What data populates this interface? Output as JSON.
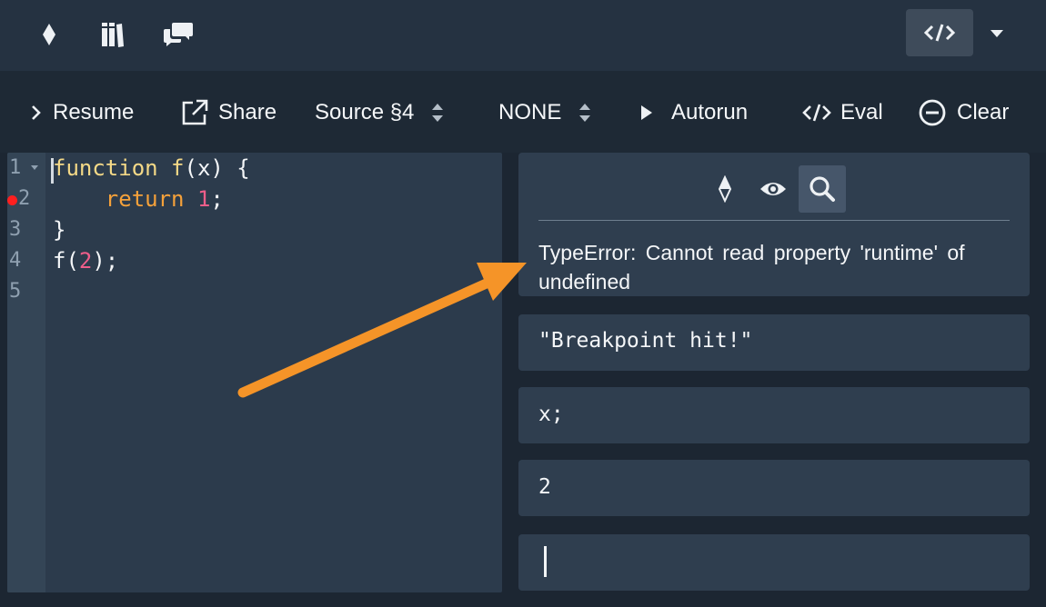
{
  "topbar": {
    "icons": [
      "playground-icon",
      "library-icon",
      "chat-icon"
    ],
    "code_toggle_icon": "code-icon",
    "dropdown_icon": "caret-down-icon"
  },
  "controls": {
    "resume": "Resume",
    "share": "Share",
    "source": "Source §4",
    "variant": "NONE",
    "autorun": "Autorun",
    "eval": "Eval",
    "clear": "Clear"
  },
  "editor": {
    "line_numbers": [
      "1",
      "2",
      "3",
      "4",
      "5"
    ],
    "breakpoint_line": "2",
    "lines": [
      {
        "kw": "function",
        "fn": "f",
        "rest": "(x) {"
      },
      {
        "ret": "return",
        "num": "1",
        "end": ";"
      },
      {
        "text": "}"
      },
      {
        "pre": "f(",
        "num": "2",
        "post": ");"
      },
      {
        "text": ""
      }
    ]
  },
  "repl": {
    "mode_icons": [
      "playground-icon",
      "eye-icon",
      "search-icon"
    ],
    "error": "TypeError: Cannot read property 'runtime' of undefined",
    "outputs": [
      "\"Breakpoint hit!\"",
      "x;",
      "2"
    ],
    "input_value": ""
  },
  "colors": {
    "accent_arrow": "#f59428",
    "breakpoint": "#ff1f1f",
    "keyword": "#f4d987",
    "return_kw": "#f5a13a",
    "number": "#ee5e8a"
  }
}
